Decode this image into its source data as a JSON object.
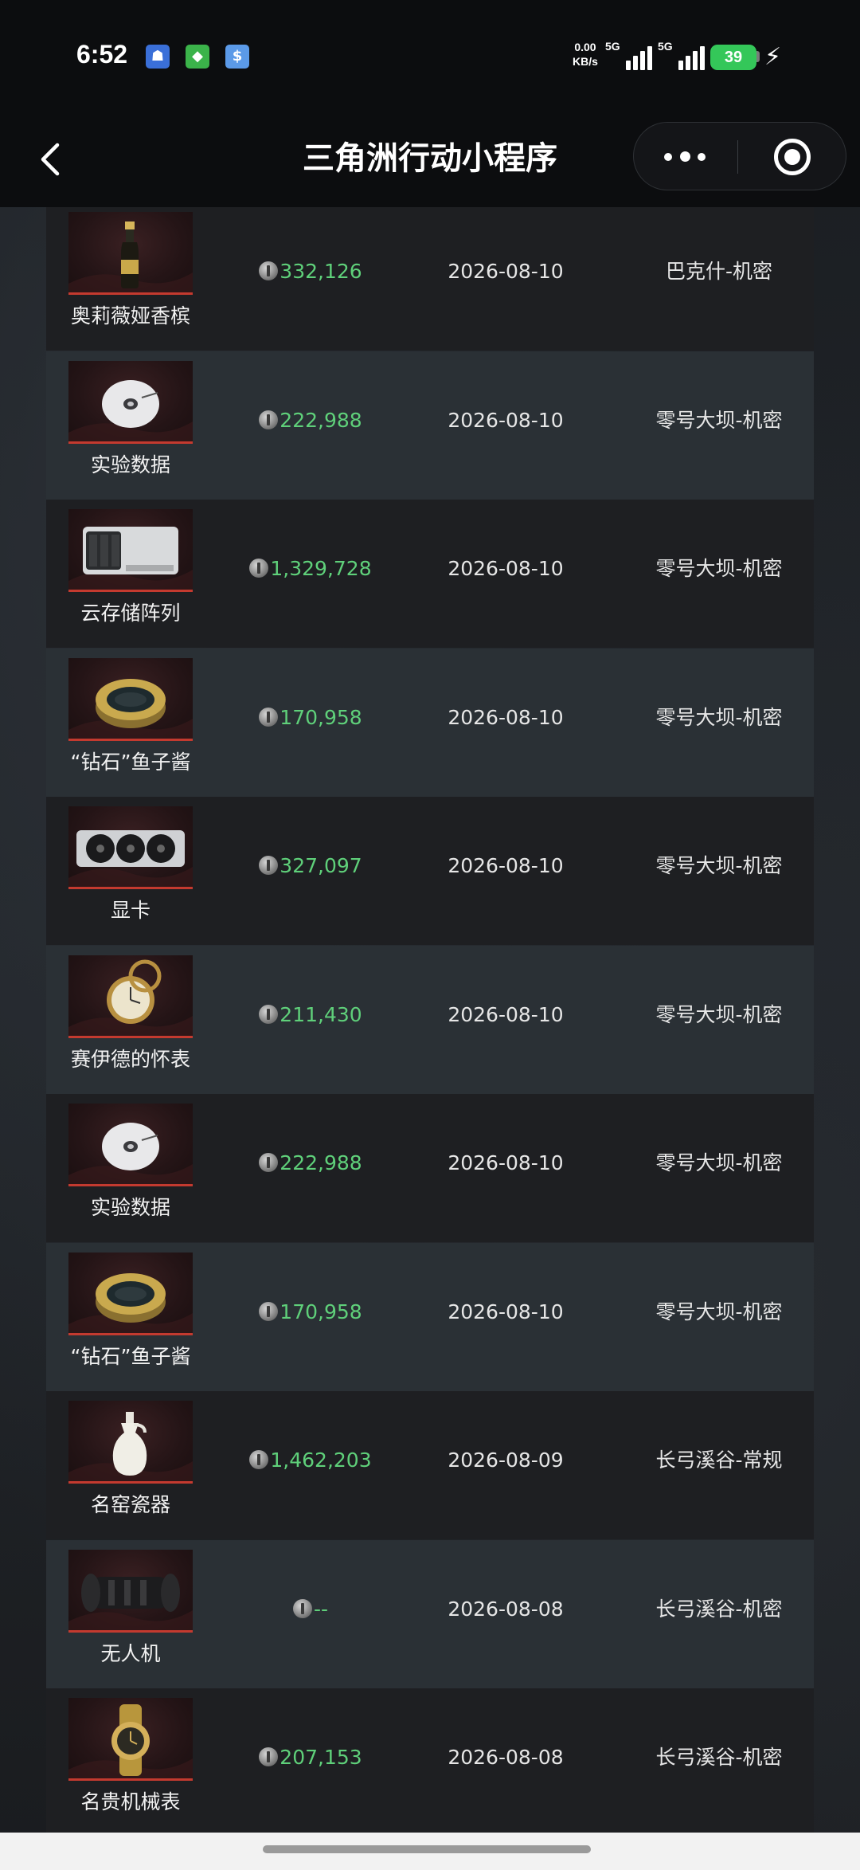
{
  "status_bar": {
    "time": "6:52",
    "net_speed_value": "0.00",
    "net_speed_unit": "KB/s",
    "signal1_label": "5G",
    "signal2_label": "5G",
    "battery": "39"
  },
  "nav": {
    "title": "三角洲行动小程序"
  },
  "rows": [
    {
      "name": "奥莉薇娅香槟",
      "price": "332,126",
      "date": "2026-08-10",
      "map": "巴克什-机密",
      "icon": "champagne-bottle-icon"
    },
    {
      "name": "实验数据",
      "price": "222,988",
      "date": "2026-08-10",
      "map": "零号大坝-机密",
      "icon": "data-disc-icon"
    },
    {
      "name": "云存储阵列",
      "price": "1,329,728",
      "date": "2026-08-10",
      "map": "零号大坝-机密",
      "icon": "storage-array-icon"
    },
    {
      "name": "“钻石”鱼子酱",
      "price": "170,958",
      "date": "2026-08-10",
      "map": "零号大坝-机密",
      "icon": "caviar-tin-icon"
    },
    {
      "name": "显卡",
      "price": "327,097",
      "date": "2026-08-10",
      "map": "零号大坝-机密",
      "icon": "graphics-card-icon"
    },
    {
      "name": "赛伊德的怀表",
      "price": "211,430",
      "date": "2026-08-10",
      "map": "零号大坝-机密",
      "icon": "pocket-watch-icon"
    },
    {
      "name": "实验数据",
      "price": "222,988",
      "date": "2026-08-10",
      "map": "零号大坝-机密",
      "icon": "data-disc-icon"
    },
    {
      "name": "“钻石”鱼子酱",
      "price": "170,958",
      "date": "2026-08-10",
      "map": "零号大坝-机密",
      "icon": "caviar-tin-icon"
    },
    {
      "name": "名窑瓷器",
      "price": "1,462,203",
      "date": "2026-08-09",
      "map": "长弓溪谷-常规",
      "icon": "porcelain-vase-icon"
    },
    {
      "name": "无人机",
      "price": "--",
      "date": "2026-08-08",
      "map": "长弓溪谷-机密",
      "icon": "drone-icon"
    },
    {
      "name": "名贵机械表",
      "price": "207,153",
      "date": "2026-08-08",
      "map": "长弓溪谷-机密",
      "icon": "wristwatch-icon"
    }
  ]
}
